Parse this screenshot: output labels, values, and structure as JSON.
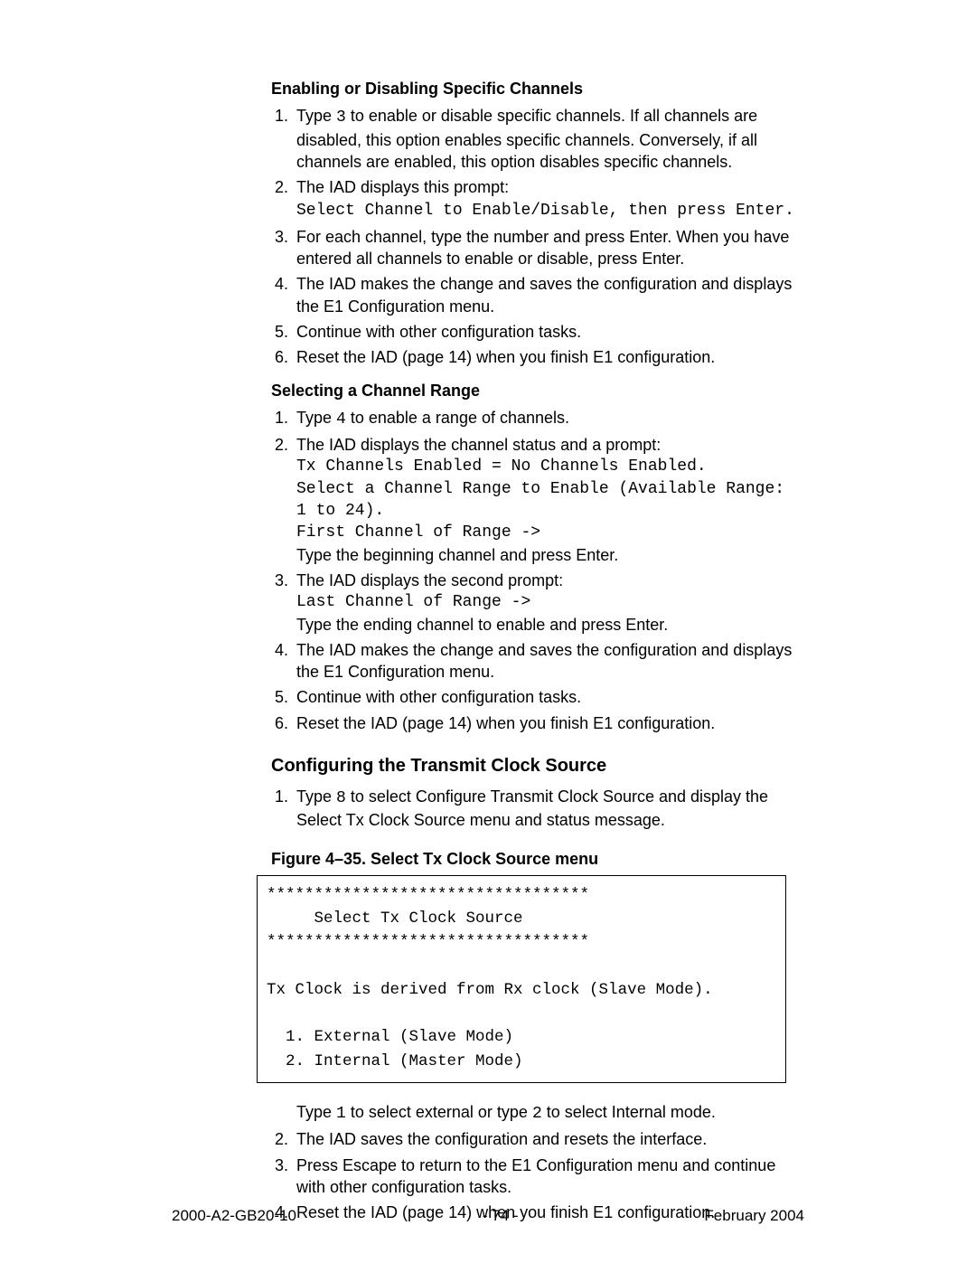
{
  "section1": {
    "heading": "Enabling or Disabling Specific Channels",
    "items": [
      {
        "pre": "Type ",
        "code": "3",
        "post": " to enable or disable specific channels. If all channels are disabled, this option enables specific channels. Conversely, if all channels are enabled, this option disables specific channels."
      },
      {
        "text": "The IAD displays this prompt:",
        "codeline": "Select Channel to Enable/Disable, then press Enter."
      },
      {
        "text": "For each channel, type the number and press Enter. When you have entered all channels to enable or disable, press Enter."
      },
      {
        "text": "The IAD makes the change and saves the configuration and displays the E1 Configuration menu."
      },
      {
        "text": "Continue with other configuration tasks."
      },
      {
        "text": "Reset the IAD (page 14) when you finish E1 configuration."
      }
    ]
  },
  "section2": {
    "heading": "Selecting a Channel Range",
    "items": [
      {
        "pre": "Type ",
        "code": "4",
        "post": "  to enable a range of channels."
      },
      {
        "text": "The IAD displays the channel status and a prompt:",
        "codeblock": "Tx Channels Enabled = No Channels Enabled.\nSelect a Channel Range to Enable (Available Range: 1 to 24).\nFirst Channel of Range ->",
        "tail": "Type the beginning channel and press Enter."
      },
      {
        "text": "The IAD displays the second prompt:",
        "codeblock": "Last Channel of Range ->",
        "tail": "Type the ending channel to enable and press Enter."
      },
      {
        "text": "The IAD makes the change and saves the configuration and displays the E1 Configuration menu."
      },
      {
        "text": "Continue with other configuration tasks."
      },
      {
        "text": "Reset the IAD (page 14) when you finish E1 configuration."
      }
    ]
  },
  "section3": {
    "heading": "Configuring the Transmit Clock Source",
    "item1": {
      "pre": "Type ",
      "code": "8",
      "post": " to select Configure Transmit Clock Source and display the Select Tx Clock Source menu and status message."
    },
    "figcaption": "Figure 4–35.  Select Tx Clock Source menu",
    "codebox": "**********************************\n     Select Tx Clock Source\n**********************************\n\nTx Clock is derived from Rx clock (Slave Mode).\n\n  1. External (Slave Mode)\n  2. Internal (Master Mode)",
    "post_line": {
      "pre": "Type ",
      "code1": "1",
      "mid": " to select external or type ",
      "code2": "2",
      "post": " to select Internal mode."
    },
    "items_rest": [
      "The IAD saves the configuration and resets the interface.",
      "Press Escape to return to the E1 Configuration menu and continue with other configuration tasks.",
      "Reset the IAD (page 14) when you finish E1 configuration."
    ]
  },
  "footer": {
    "left": "2000-A2-GB20-10",
    "center": "- 74 -",
    "right": "February 2004"
  }
}
